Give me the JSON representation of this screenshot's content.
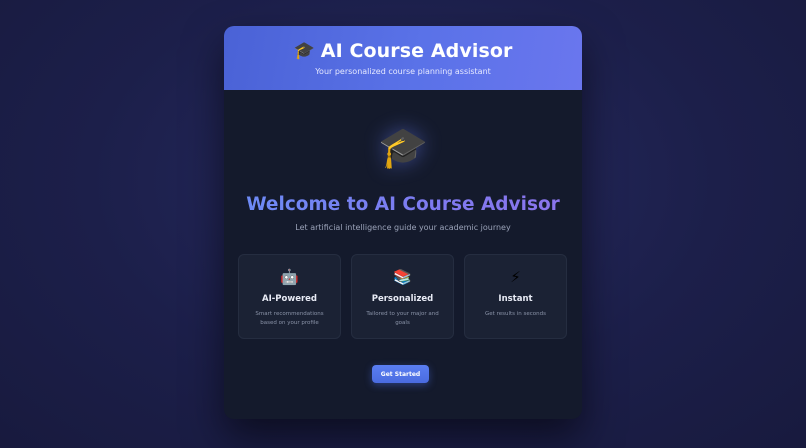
{
  "header": {
    "title": "AI Course Advisor",
    "icon": "graduation-cap-icon",
    "subtitle": "Your personalized course planning assistant"
  },
  "welcome": {
    "icon": "graduation-cap-icon",
    "title": "Welcome to AI Course Advisor",
    "subtitle": "Let artificial intelligence guide your academic journey"
  },
  "features": [
    {
      "icon": "robot-icon",
      "title": "AI-Powered",
      "description": "Smart recommendations based on your profile"
    },
    {
      "icon": "books-icon",
      "title": "Personalized",
      "description": "Tailored to your major and goals"
    },
    {
      "icon": "lightning-icon",
      "title": "Instant",
      "description": "Get results in seconds"
    }
  ],
  "cta": {
    "label": "Get Started"
  },
  "colors": {
    "header_gradient_start": "#4a62d6",
    "header_gradient_end": "#6a76ee",
    "card_background": "#141a2c",
    "feature_background": "#1b2234",
    "accent": "#5a7ef2"
  }
}
